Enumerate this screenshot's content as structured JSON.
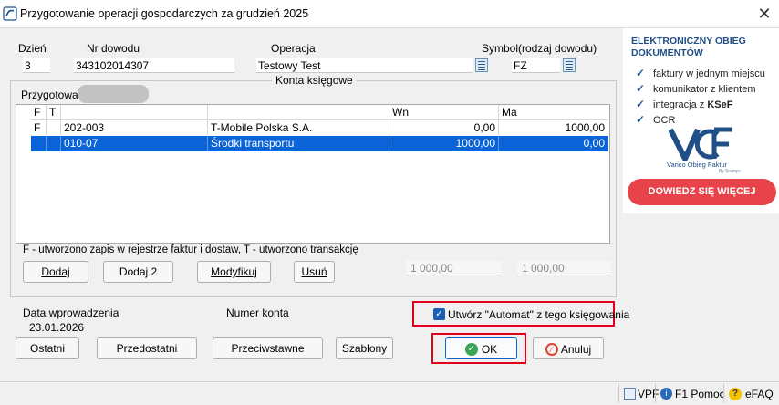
{
  "window": {
    "title": "Przygotowanie operacji gospodarczych za grudzień 2025",
    "close_label": "✕"
  },
  "form": {
    "day_label": "Dzień",
    "day_value": "3",
    "doc_no_label": "Nr dowodu",
    "doc_no_value": "343102014307",
    "operation_label": "Operacja",
    "operation_value": "Testowy Test",
    "symbol_label": "Symbol(rodzaj dowodu)",
    "symbol_value": "FZ"
  },
  "accounts": {
    "group_title": "Konta księgowe",
    "prepared_by_label": "Przygotował",
    "columns": [
      "F",
      "T",
      "",
      "",
      "Wn",
      "Ma"
    ],
    "rows": [
      {
        "f": "F",
        "t": "",
        "account": "202-003",
        "name": "T-Mobile Polska S.A.",
        "wn": "0,00",
        "ma": "1000,00",
        "selected": false
      },
      {
        "f": "",
        "t": "",
        "account": "010-07",
        "name": "Środki transportu",
        "wn": "1000,00",
        "ma": "0,00",
        "selected": true
      }
    ],
    "legend_note": "F - utworzono zapis w rejestrze faktur i dostaw, T - utworzono transakcję",
    "buttons": {
      "add": "Dodaj",
      "add2": "Dodaj 2",
      "modify": "Modyfikuj",
      "delete": "Usuń"
    },
    "sum_wn": "1 000,00",
    "sum_ma": "1 000,00"
  },
  "footer": {
    "entry_date_label": "Data wprowadzenia",
    "entry_date_value": "23.01.2026",
    "account_number_label": "Numer konta",
    "automat_checkbox_label": "Utwórz \"Automat\" z tego księgowania",
    "automat_checked": true,
    "buttons": {
      "last": "Ostatni",
      "second_last": "Przedostatni",
      "opposite": "Przeciwstawne",
      "templates": "Szablony",
      "ok": "OK",
      "cancel": "Anuluj"
    }
  },
  "ad": {
    "title_line1": "ELEKTRONICZNY OBIEG",
    "title_line2": "DOKUMENTÓW",
    "items": [
      "faktury w jednym miejscu",
      "komunikator z klientem",
      "integracja z ",
      "OCR"
    ],
    "item3_bold": "KSeF",
    "logo_caption": "Varico Obieg Faktur",
    "logo_byline": "By Scanye",
    "cta": "DOWIEDZ SIĘ WIĘCEJ"
  },
  "statusbar": {
    "vpf": "VPF",
    "help": "F1 Pomoc",
    "efaq": "eFAQ"
  },
  "colors": {
    "selection": "#0a64d8",
    "highlight_border": "#e0001b",
    "ad_cta": "#e8434a",
    "ad_title": "#1f4f86"
  }
}
